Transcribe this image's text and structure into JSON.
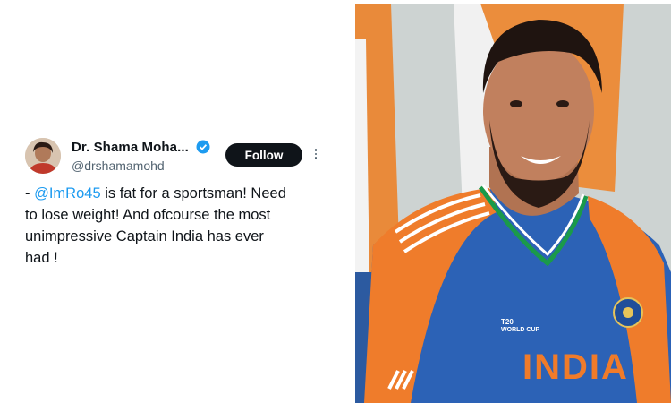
{
  "tweet": {
    "display_name": "Dr. Shama Moha...",
    "handle": "@drshamamohd",
    "follow_label": "Follow",
    "mention": "@ImRo45",
    "line1_prefix": "- ",
    "line1_rest": " is fat for a sportsman! Need",
    "line2": "to lose weight! And ofcourse the most",
    "line3": "unimpressive Captain India has ever",
    "line4": "had  !",
    "accent_color": "#1d9bf0"
  },
  "photo": {
    "jersey_text": "INDIA",
    "logo_line1": "WORLD CUP",
    "logo_line2": "T20"
  },
  "icons": [
    "verified-badge-icon",
    "more-options-icon"
  ]
}
